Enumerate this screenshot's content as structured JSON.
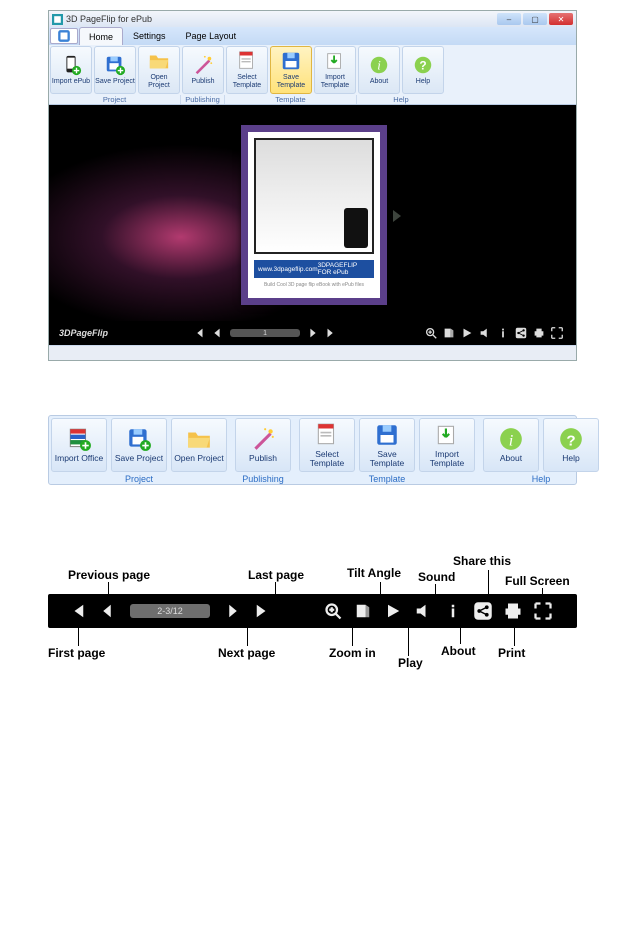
{
  "window": {
    "title": "3D PageFlip for ePub",
    "menu": {
      "home": "Home",
      "settings": "Settings",
      "pagelayout": "Page Layout"
    }
  },
  "ribbon": {
    "import_epub": "Import ePub",
    "save_project": "Save Project",
    "open_project": "Open Project",
    "publish": "Publish",
    "select_template": "Select Template",
    "save_template": "Save Template",
    "import_template": "Import Template",
    "about": "About",
    "help": "Help",
    "group_project": "Project",
    "group_publishing": "Publishing",
    "group_template": "Template",
    "group_help": "Help"
  },
  "stage": {
    "brand": "3DPageFlip",
    "band_left": "www.3dpageflip.com",
    "band_right": "3DPAGEFLIP FOR ePub",
    "caption": "Build Cool 3D page flip eBook with ePub files",
    "page_small": "1"
  },
  "ribbon_large": {
    "import_office": "Import Office",
    "save_project": "Save Project",
    "open_project": "Open Project",
    "publish": "Publish",
    "select_template": "Select Template",
    "save_template": "Save Template",
    "import_template": "Import Template",
    "about": "About",
    "help": "Help",
    "group_project": "Project",
    "group_publishing": "Publishing",
    "group_template": "Template",
    "group_help": "Help"
  },
  "bt": {
    "range": "2-3/12",
    "labels": {
      "first": "First page",
      "prev": "Previous page",
      "next": "Next page",
      "last": "Last page",
      "zoom": "Zoom in",
      "tilt": "Tilt Angle",
      "play": "Play",
      "sound": "Sound",
      "about": "About",
      "share": "Share this",
      "print": "Print",
      "full": "Full Screen"
    }
  }
}
